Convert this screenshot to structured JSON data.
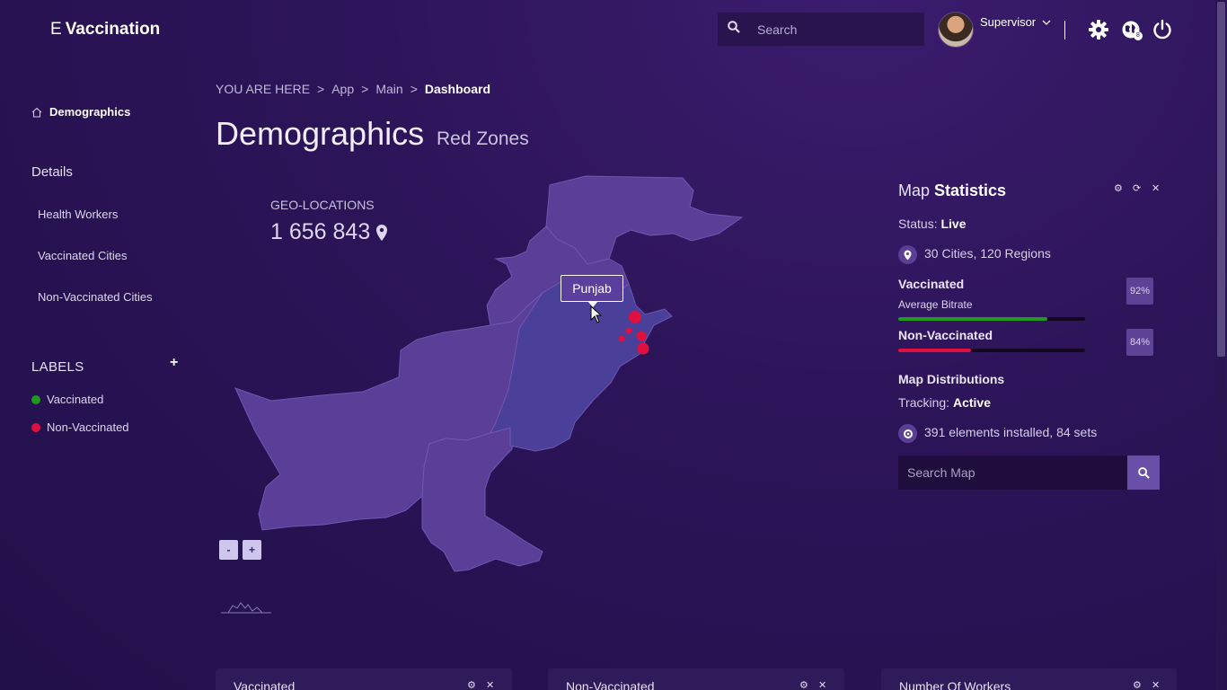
{
  "brand": {
    "prefix": "E",
    "name": "Vaccination"
  },
  "header": {
    "search_placeholder": "Search",
    "user_name": "Supervisor",
    "notification_count": "8"
  },
  "sidebar": {
    "home": "Demographics",
    "details_heading": "Details",
    "items": [
      {
        "label": "Health Workers"
      },
      {
        "label": "Vaccinated Cities"
      },
      {
        "label": "Non-Vaccinated Cities"
      }
    ],
    "labels_heading": "LABELS",
    "labels_add": "+",
    "legend": [
      {
        "label": "Vaccinated",
        "color": "#1f9b1f"
      },
      {
        "label": "Non-Vaccinated",
        "color": "#e0103e"
      }
    ]
  },
  "breadcrumb": {
    "items": [
      "YOU ARE HERE",
      "App",
      "Main"
    ],
    "separator": ">",
    "current": "Dashboard"
  },
  "page": {
    "title": "Demographics",
    "subtitle": "Red Zones"
  },
  "geo": {
    "label": "GEO-LOCATIONS",
    "value": "1 656 843"
  },
  "map": {
    "tooltip": "Punjab",
    "zoom_out": "-",
    "zoom_in": "+",
    "region_color": "#5a3e98",
    "highlight_color": "#4a3f99",
    "hotspot_color": "#e0103e"
  },
  "stats": {
    "title_light": "Map",
    "title_bold": "Statistics",
    "status_label": "Status:",
    "status_value": "Live",
    "cities": "30 Cities, 120 Regions",
    "vaccinated": {
      "name": "Vaccinated",
      "sub": "Average Bitrate",
      "percent": "92%",
      "fill": 0.8,
      "color": "#1f9b1f"
    },
    "non_vaccinated": {
      "name": "Non-Vaccinated",
      "percent": "84%",
      "fill": 0.39,
      "color": "#e0103e"
    },
    "distributions": "Map Distributions",
    "tracking_label": "Tracking:",
    "tracking_value": "Active",
    "installed": "391 elements installed, 84 sets",
    "search_placeholder": "Search Map"
  },
  "cards": [
    {
      "title": "Vaccinated"
    },
    {
      "title": "Non-Vaccinated"
    },
    {
      "title": "Number Of Workers"
    }
  ]
}
